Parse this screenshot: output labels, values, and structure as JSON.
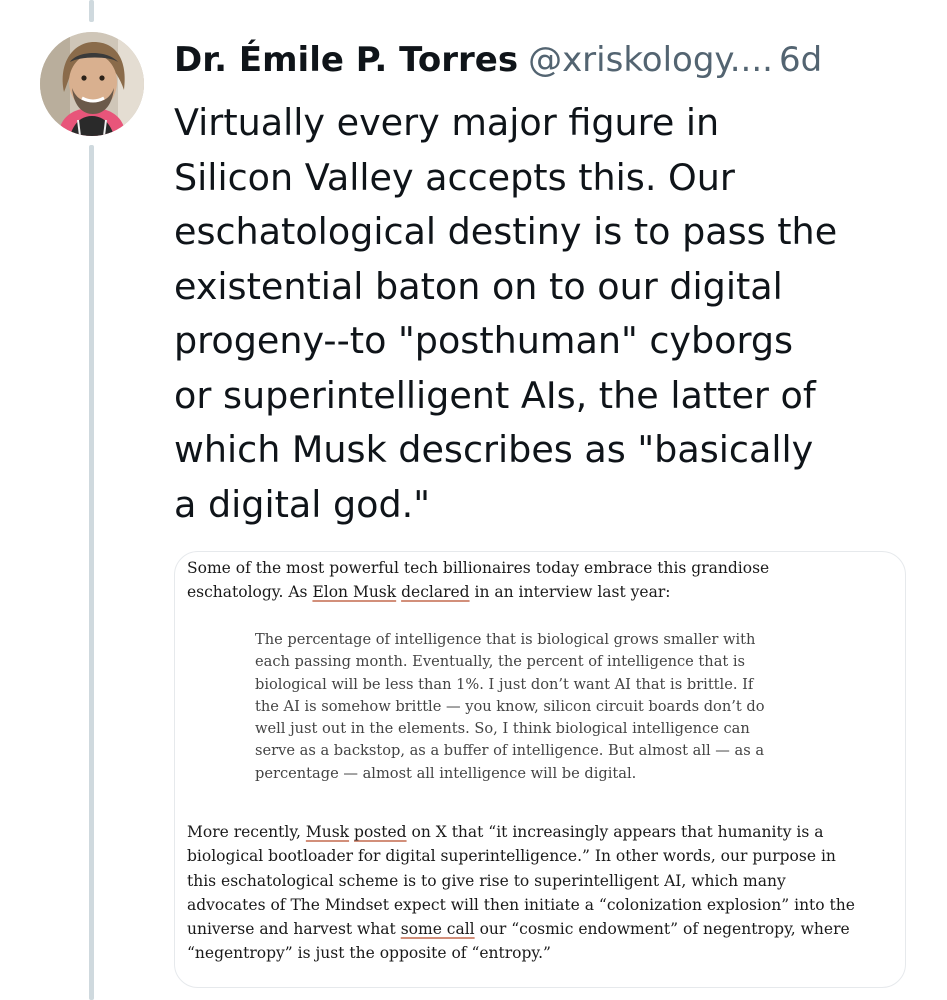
{
  "post": {
    "author_name": "Dr. Émile P. Torres",
    "handle": "@xriskology....",
    "timestamp": "6d",
    "text": "Virtually every major figure in\nSilicon Valley accepts this. Our\neschatological destiny is to pass the\nexistential baton on to our digital\nprogeny--to \"posthuman\" cyborgs\nor superintelligent AIs, the latter of\nwhich Musk describes as \"basically\na digital god.\""
  },
  "image": {
    "para1": {
      "line1": "Some of the most powerful tech billionaires today embrace this grandiose",
      "line2_pre": "eschatology. As ",
      "line2_link1": "Elon Musk",
      "line2_space": " ",
      "line2_link2": "declared",
      "line2_post": " in an interview last year:"
    },
    "quote_lines": [
      "The percentage of intelligence that is biological grows smaller with",
      "each passing month. Eventually, the percent of intelligence that is",
      "biological will be less than 1%. I just don’t want AI that is brittle. If",
      "the AI is somehow brittle — you know, silicon circuit boards don’t do",
      "well just out in the elements. So, I think biological intelligence can",
      "serve as a backstop, as a buffer of intelligence. But almost all — as a",
      "percentage — almost all intelligence will be digital."
    ],
    "para2": {
      "line1_pre": "More recently, ",
      "line1_link1": "Musk",
      "line1_space": " ",
      "line1_link2": "posted",
      "line1_post": " on X that “it increasingly appears that humanity is a",
      "line2": "biological bootloader for digital superintelligence.” In other words, our purpose in",
      "line3": "this eschatological scheme is to give rise to superintelligent AI, which many",
      "line4": "advocates of The Mindset expect will then initiate a “colonization explosion” into the",
      "line5_pre": "universe and harvest what ",
      "line5_link": "some call",
      "line5_post": " our “cosmic endowment” of negentropy, where",
      "line6": "“negentropy” is just the opposite of “entropy.”"
    }
  },
  "colors": {
    "text_primary": "#0f1419",
    "text_secondary": "#536471",
    "thread_line": "#cfd9de",
    "link_underline": "#d28f7a"
  }
}
